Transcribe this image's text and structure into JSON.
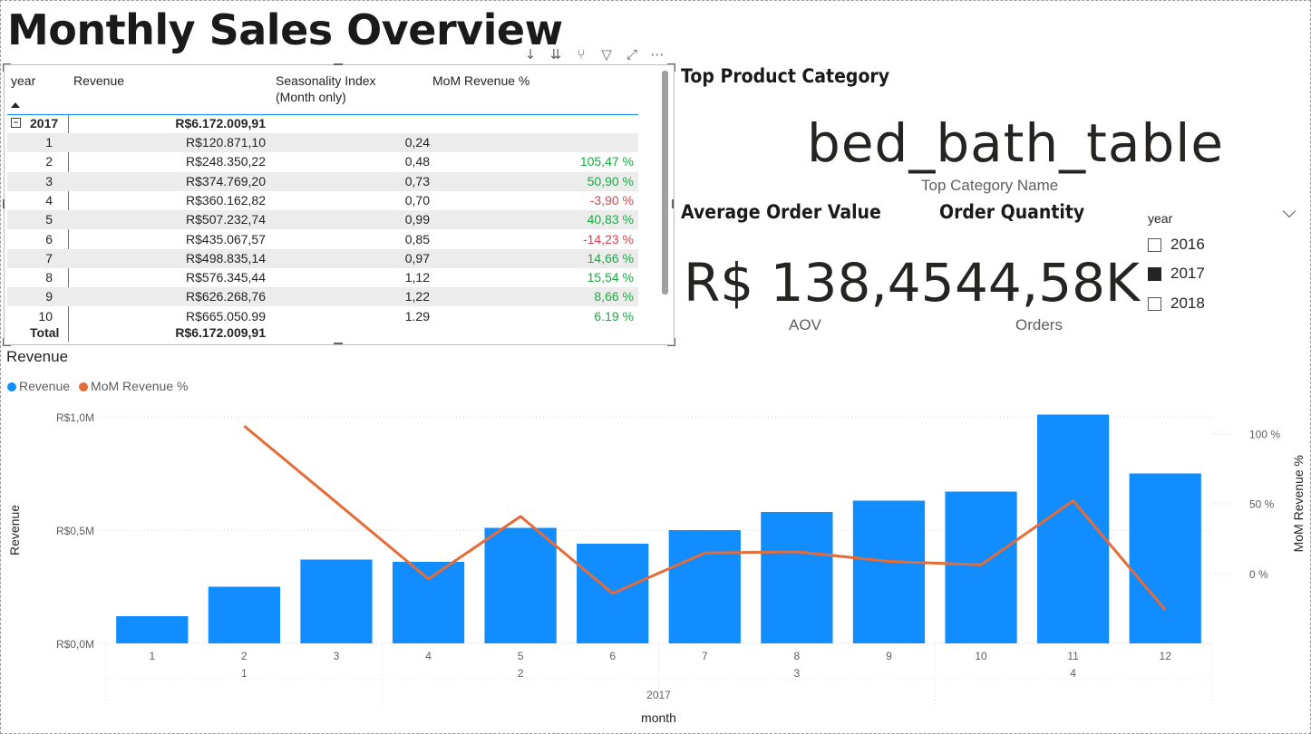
{
  "page": {
    "title": "Monthly Sales Overview"
  },
  "table": {
    "headers": {
      "year": "year",
      "revenue": "Revenue",
      "seasonality": "Seasonality Index\n(Month only)",
      "mom": "MoM Revenue %"
    },
    "group": {
      "year": "2017",
      "revenue": "R$6.172.009,91"
    },
    "rows": [
      {
        "month": "1",
        "revenue": "R$120.871,10",
        "seasonality": "0,24",
        "mom": "",
        "dir": "none"
      },
      {
        "month": "2",
        "revenue": "R$248.350,22",
        "seasonality": "0,48",
        "mom": "105,47 %",
        "dir": "pos"
      },
      {
        "month": "3",
        "revenue": "R$374.769,20",
        "seasonality": "0,73",
        "mom": "50,90 %",
        "dir": "pos"
      },
      {
        "month": "4",
        "revenue": "R$360.162,82",
        "seasonality": "0,70",
        "mom": "-3,90 %",
        "dir": "neg"
      },
      {
        "month": "5",
        "revenue": "R$507.232,74",
        "seasonality": "0,99",
        "mom": "40,83 %",
        "dir": "pos"
      },
      {
        "month": "6",
        "revenue": "R$435.067,57",
        "seasonality": "0,85",
        "mom": "-14,23 %",
        "dir": "neg"
      },
      {
        "month": "7",
        "revenue": "R$498.835,14",
        "seasonality": "0,97",
        "mom": "14,66 %",
        "dir": "pos"
      },
      {
        "month": "8",
        "revenue": "R$576.345,44",
        "seasonality": "1,12",
        "mom": "15,54 %",
        "dir": "pos"
      },
      {
        "month": "9",
        "revenue": "R$626.268,76",
        "seasonality": "1,22",
        "mom": "8,66 %",
        "dir": "pos"
      },
      {
        "month": "10",
        "revenue": "R$665.050.99",
        "seasonality": "1.29",
        "mom": "6.19 %",
        "dir": "pos"
      }
    ],
    "total": {
      "label": "Total",
      "revenue": "R$6.172.009,91"
    }
  },
  "cards": {
    "top_category": {
      "title": "Top Product Category",
      "value": "bed_bath_table",
      "label": "Top Category Name"
    },
    "aov": {
      "title": "Average Order Value",
      "value": "R$ 138,45",
      "label": "AOV"
    },
    "orders": {
      "title": "Order Quantity",
      "value": "44,58K",
      "label": "Orders"
    }
  },
  "slicer": {
    "title": "year",
    "options": [
      {
        "label": "2016",
        "checked": false
      },
      {
        "label": "2017",
        "checked": true
      },
      {
        "label": "2018",
        "checked": false
      }
    ]
  },
  "colors": {
    "revenue": "#118dff",
    "mom": "#e66c37",
    "positive": "#1aab40",
    "negative": "#d64554"
  },
  "chart_data": {
    "type": "bar",
    "title": "Revenue",
    "xlabel": "month",
    "ylabel": "Revenue",
    "y2label": "MoM Revenue %",
    "categories": [
      "1",
      "2",
      "3",
      "4",
      "5",
      "6",
      "7",
      "8",
      "9",
      "10",
      "11",
      "12"
    ],
    "quarters": [
      "1",
      "2",
      "3",
      "4"
    ],
    "year_label": "2017",
    "ylim": [
      0,
      1.08
    ],
    "y_ticks": [
      0,
      0.5,
      1.0
    ],
    "y_tick_labels": [
      "R$0,0M",
      "R$0,5M",
      "R$1,0M"
    ],
    "y2lim": [
      -50,
      125
    ],
    "y2_ticks": [
      0,
      50,
      100
    ],
    "y2_tick_labels": [
      "0 %",
      "50 %",
      "100 %"
    ],
    "legend": "top-left",
    "grid": true,
    "series": [
      {
        "name": "Revenue",
        "type": "bar",
        "values": [
          0.12,
          0.25,
          0.37,
          0.36,
          0.51,
          0.44,
          0.5,
          0.58,
          0.63,
          0.67,
          1.01,
          0.75
        ]
      },
      {
        "name": "MoM Revenue %",
        "type": "line",
        "axis": "right",
        "values": [
          null,
          105.47,
          50.9,
          -3.9,
          40.83,
          -14.23,
          14.66,
          15.54,
          8.66,
          6.19,
          52,
          -26
        ]
      }
    ]
  }
}
